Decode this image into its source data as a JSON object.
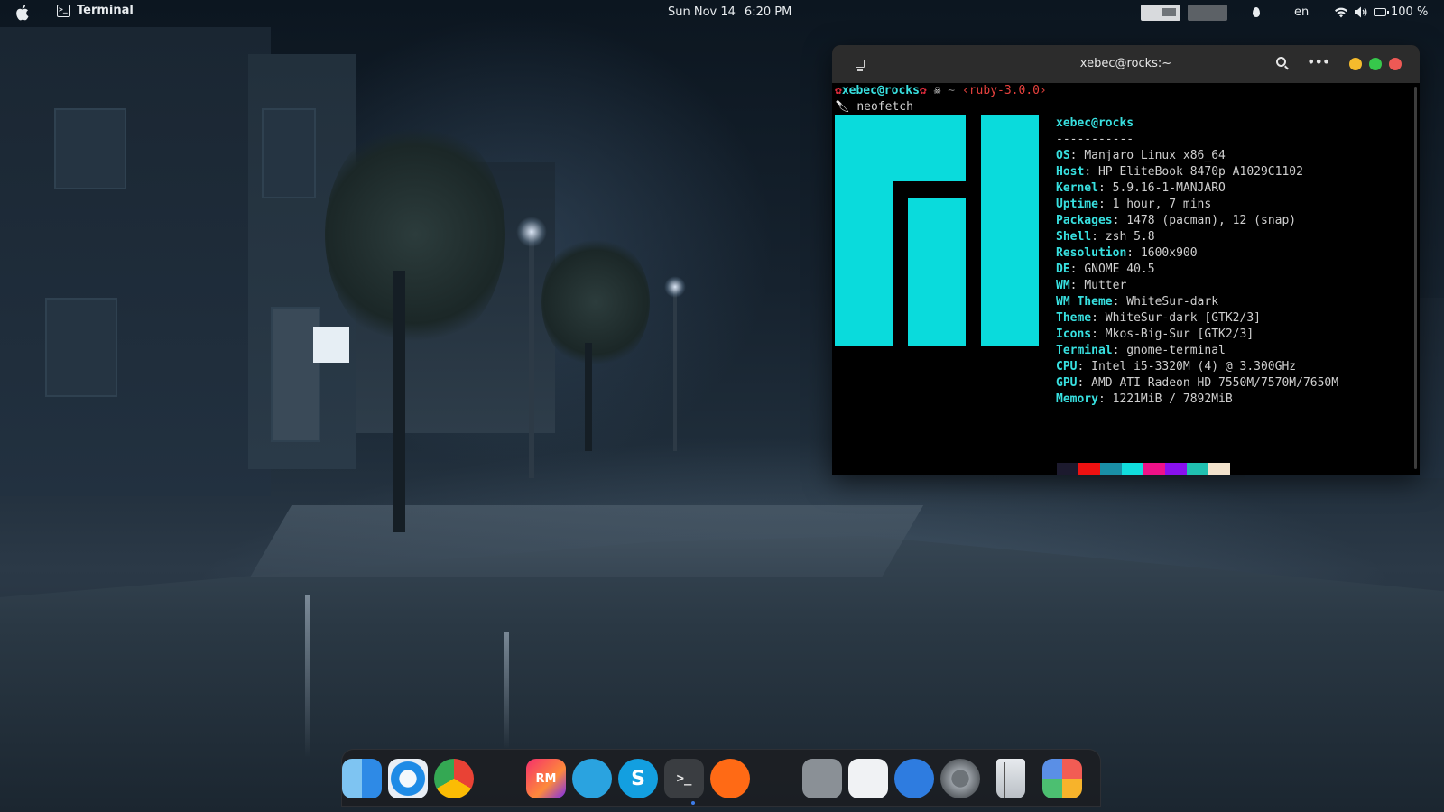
{
  "topbar": {
    "app_name": "Terminal",
    "date": "Sun Nov 14",
    "time": "6:20 PM",
    "language": "en",
    "battery": "100 %"
  },
  "terminal": {
    "title": "xebec@rocks:~",
    "prompt": {
      "user_host": "xebec@rocks",
      "path": "~",
      "ruby": "‹ruby-3.0.0›"
    },
    "command": "neofetch",
    "neofetch": {
      "header": "xebec@rocks",
      "separator": "-----------",
      "fields": [
        {
          "key": "OS",
          "value": "Manjaro Linux x86_64"
        },
        {
          "key": "Host",
          "value": "HP EliteBook 8470p A1029C1102"
        },
        {
          "key": "Kernel",
          "value": "5.9.16-1-MANJARO"
        },
        {
          "key": "Uptime",
          "value": "1 hour, 7 mins"
        },
        {
          "key": "Packages",
          "value": "1478 (pacman), 12 (snap)"
        },
        {
          "key": "Shell",
          "value": "zsh 5.8"
        },
        {
          "key": "Resolution",
          "value": "1600x900"
        },
        {
          "key": "DE",
          "value": "GNOME 40.5"
        },
        {
          "key": "WM",
          "value": "Mutter"
        },
        {
          "key": "WM Theme",
          "value": "WhiteSur-dark"
        },
        {
          "key": "Theme",
          "value": "WhiteSur-dark [GTK2/3]"
        },
        {
          "key": "Icons",
          "value": "Mkos-Big-Sur [GTK2/3]"
        },
        {
          "key": "Terminal",
          "value": "gnome-terminal"
        },
        {
          "key": "CPU",
          "value": "Intel i5-3320M (4) @ 3.300GHz"
        },
        {
          "key": "GPU",
          "value": "AMD ATI Radeon HD 7550M/7570M/7650M"
        },
        {
          "key": "Memory",
          "value": "1221MiB / 7892MiB"
        }
      ],
      "palette_top": [
        "#1c1a2e",
        "#ee1111",
        "#1a8fa6",
        "#11dddd",
        "#ee1188",
        "#8811ee",
        "#20c0b0",
        "#f2e2cc"
      ],
      "palette_bottom": [
        "#3a3a3a",
        "#d22e32",
        "#0bd1d8",
        "#0fa870",
        "#0fa870",
        "#9a55e0",
        "#10eeee",
        "#ffffff"
      ],
      "logo_color": "#0adbdc"
    }
  },
  "dock": {
    "apps": [
      {
        "name": "finder-icon",
        "label": ""
      },
      {
        "name": "safari-icon",
        "label": ""
      },
      {
        "name": "chrome-icon",
        "label": ""
      },
      {
        "name": "vscode-icon",
        "label": ""
      },
      {
        "name": "rubymine-icon",
        "label": "RM"
      },
      {
        "name": "telegram-icon",
        "label": ""
      },
      {
        "name": "skype-icon",
        "label": "S"
      },
      {
        "name": "terminal-icon",
        "label": ">_"
      },
      {
        "name": "soundcloud-icon",
        "label": ""
      },
      {
        "name": "podcast-mic-icon",
        "label": ""
      },
      {
        "name": "vm-icon",
        "label": ""
      },
      {
        "name": "screenshot-icon",
        "label": ""
      },
      {
        "name": "software-update-icon",
        "label": ""
      },
      {
        "name": "system-settings-icon",
        "label": ""
      },
      {
        "name": "trash-icon",
        "label": ""
      },
      {
        "name": "launchpad-icon",
        "label": ""
      }
    ]
  }
}
